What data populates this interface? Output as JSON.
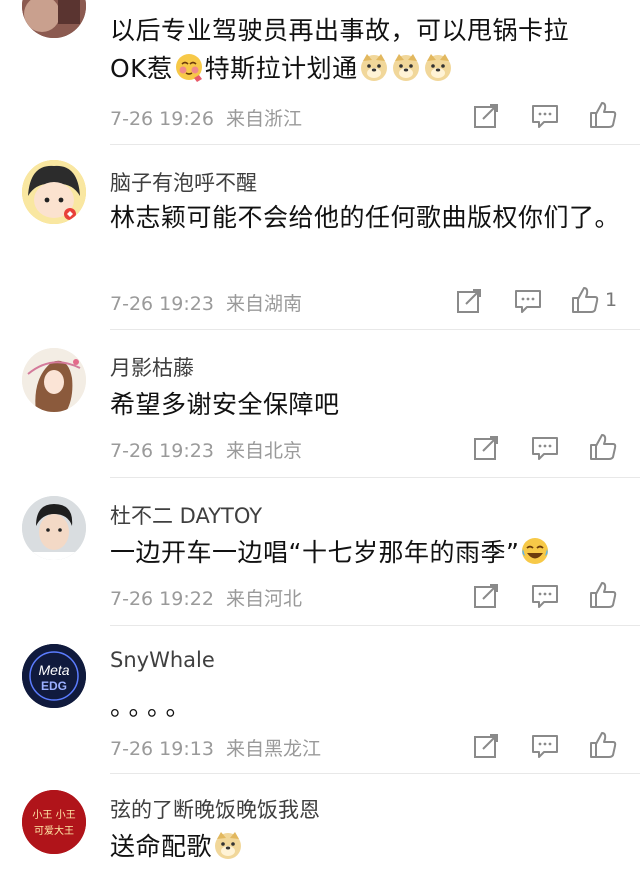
{
  "comments": [
    {
      "username": "",
      "text_line1": "以后专业驾驶员再出事故，可以甩锅卡拉",
      "text_line2_a": "OK惹",
      "text_line2_b": "特斯拉计划通",
      "time": "7-26 19:26",
      "location": "来自浙江",
      "likes": ""
    },
    {
      "username": "脑子有泡呼不醒",
      "text": "林志颖可能不会给他的任何歌曲版权你们了。",
      "time": "7-26 19:23",
      "location": "来自湖南",
      "likes": "1"
    },
    {
      "username": "月影枯藤",
      "text": "希望多谢安全保障吧",
      "time": "7-26 19:23",
      "location": "来自北京",
      "likes": ""
    },
    {
      "username": "杜不二 DAYTOY",
      "text": "一边开车一边唱“十七岁那年的雨季”",
      "time": "7-26 19:22",
      "location": "来自河北",
      "likes": ""
    },
    {
      "username": "SnyWhale",
      "avatar_text": "Meta EDG",
      "text": "。。。。",
      "time": "7-26 19:13",
      "location": "来自黑龙江",
      "likes": ""
    },
    {
      "username": "弦的了断晚饭晚饭我恩",
      "avatar_text": "小王 小王 可爱大王",
      "text": "送命配歌",
      "time": "",
      "location": "",
      "likes": ""
    }
  ],
  "colors": {
    "text": "#111111",
    "meta": "#9a9a9a",
    "icon": "#8a8a8a",
    "divider": "#e8e8e8"
  },
  "icons": [
    "share-icon",
    "comment-icon",
    "like-icon",
    "doge-emoji",
    "blush-emoji",
    "laugh-cry-emoji"
  ]
}
